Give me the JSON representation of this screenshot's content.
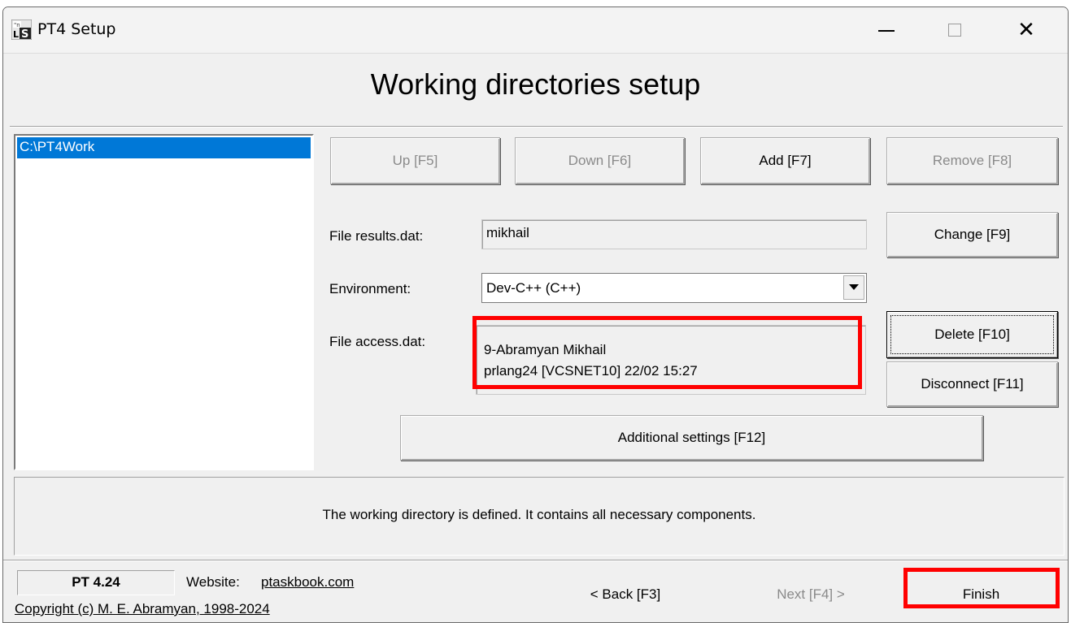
{
  "window": {
    "title": "PT4 Setup",
    "icon_name": "pt4-app-icon",
    "controls": [
      "minimize-icon",
      "maximize-icon",
      "close-icon"
    ],
    "close_glyph": "✕"
  },
  "header": {
    "title": "Working directories setup"
  },
  "directories": {
    "items": [
      "C:\\PT4Work"
    ],
    "selected_index": 0
  },
  "toolbar": {
    "up": "Up [F5]",
    "down": "Down [F6]",
    "add": "Add [F7]",
    "remove": "Remove [F8]"
  },
  "results": {
    "label": "File results.dat:",
    "value": "mikhail",
    "change": "Change [F9]"
  },
  "environment": {
    "label": "Environment:",
    "selected": "Dev-C++ (C++)"
  },
  "access": {
    "label": "File access.dat:",
    "lines": [
      "9-Abramyan Mikhail",
      "prlang24 [VCSNET10] 22/02 15:27"
    ],
    "delete": "Delete [F10]",
    "disconnect": "Disconnect [F11]"
  },
  "additional": {
    "label": "Additional settings [F12]"
  },
  "status": {
    "message": "The working directory is defined. It contains all necessary components."
  },
  "footer": {
    "version": "PT 4.24",
    "website_label": "Website:",
    "website_link": "ptaskbook.com",
    "copyright": "Copyright (c) M. E. Abramyan, 1998-2024",
    "back": "< Back [F3]",
    "next": "Next [F4] >",
    "finish": "Finish"
  },
  "colors": {
    "highlight": "#ff0000",
    "selection": "#0078d7"
  }
}
